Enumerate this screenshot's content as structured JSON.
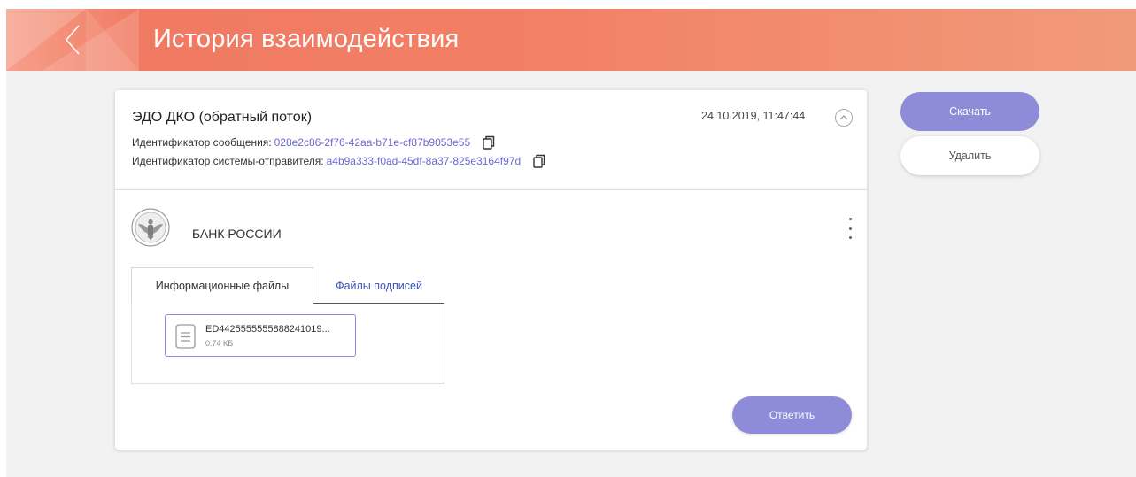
{
  "header": {
    "title": "История взаимодействия",
    "back_icon": "chevron-left-icon"
  },
  "message": {
    "type": "ЭДО ДКО (обратный поток)",
    "datetime": "24.10.2019, 11:47:44",
    "message_id_label": "Идентификатор сообщения:",
    "message_id": "028e2c86-2f76-42aa-b71e-cf87b9053e55",
    "sender_id_label": "Идентификатор системы-отправителя:",
    "sender_id": "a4b9a333-f0ad-45df-8a37-825e3164f97d"
  },
  "sender": {
    "name": "БАНК РОССИИ"
  },
  "tabs": [
    {
      "label": "Информационные файлы",
      "active": true
    },
    {
      "label": "Файлы подписей",
      "active": false
    }
  ],
  "files": [
    {
      "name": "ED4425555555888241019...",
      "size": "0.74 КБ"
    }
  ],
  "actions": {
    "reply": "Ответить",
    "download": "Скачать",
    "delete": "Удалить"
  },
  "colors": {
    "accent": "#8e8cd8",
    "link": "#6b68d0",
    "header_start": "#f07a62",
    "header_end": "#f19a79"
  }
}
